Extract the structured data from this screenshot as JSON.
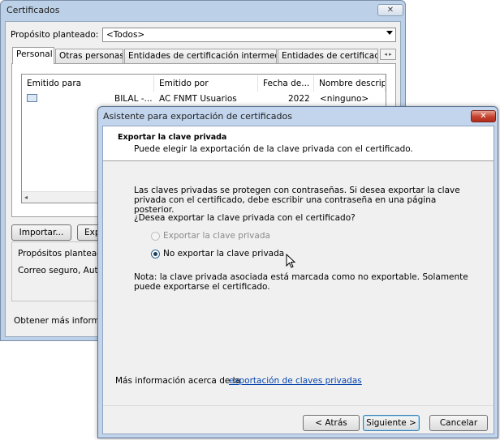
{
  "certificates_window": {
    "title": "Certificados",
    "close_glyph": "✕",
    "purpose_label": "Propósito planteado:",
    "purpose_value": "<Todos>",
    "tabs": [
      "Personal",
      "Otras personas",
      "Entidades de certificación intermedias",
      "Entidades de certificac"
    ],
    "tab_scroll": "◂ ▸",
    "columns": [
      "Emitido para",
      "Emitido por",
      "Fecha de...",
      "Nombre descriptiv"
    ],
    "rows": [
      {
        "issued_to": "BILAL -...",
        "issued_by": "AC FNMT Usuarios",
        "expiry": "2022",
        "friendly_name": "<ninguno>"
      }
    ],
    "hscroll_glyph": "◂",
    "import_label": "Importar...",
    "export_label": "Exp",
    "purposes_label": "Propósitos planteado",
    "purposes_value": "Correo seguro, Aute",
    "more_info": "Obtener más informac"
  },
  "export_wizard": {
    "title": "Asistente para exportación de certificados",
    "close_glyph": "✕",
    "header_title": "Exportar la clave privada",
    "header_subtitle": "Puede elegir la exportación de la clave privada con el certificado.",
    "body_text": "Las claves privadas se protegen con contraseñas. Si desea exportar la clave privada con el certificado, debe escribir una contraseña en una página posterior.",
    "question": "¿Desea exportar la clave privada con el certificado?",
    "option_export": "Exportar la clave privada",
    "option_no_export": "No exportar la clave privada",
    "selected_option": "No exportar la clave privada",
    "note": "Nota: la clave privada asociada está marcada como no exportable. Solamente puede exportarse el certificado.",
    "more_info_prefix": "Más información acerca de la",
    "more_info_link": "exportación de claves privadas",
    "back_label": "< Atrás",
    "next_label": "Siguiente >",
    "cancel_label": "Cancelar"
  },
  "cursor_glyph": "⇖"
}
